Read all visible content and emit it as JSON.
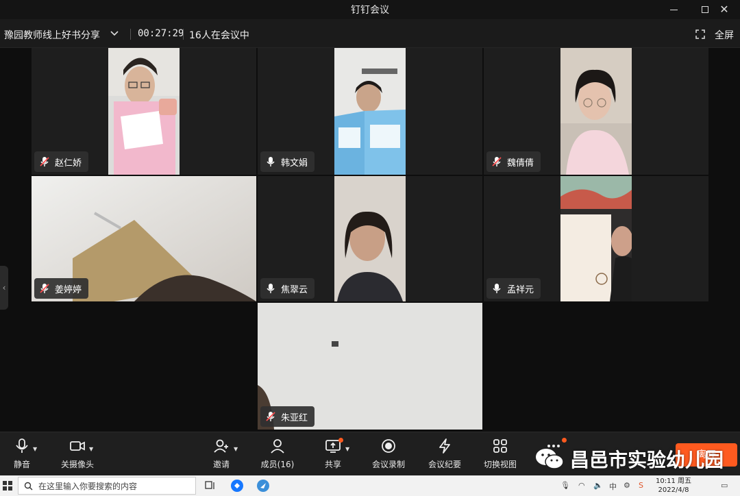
{
  "window": {
    "title": "钉钉会议"
  },
  "meeting": {
    "title": "豫园教师线上好书分享",
    "elapsed": "00:27:29",
    "participants_text": "16人在会议中",
    "fullscreen_label": "全屏"
  },
  "participants": [
    {
      "name": "赵仁娇",
      "mic": "muted"
    },
    {
      "name": "韩文娟",
      "mic": "on"
    },
    {
      "name": "魏倩倩",
      "mic": "muted"
    },
    {
      "name": "姜婷婷",
      "mic": "muted"
    },
    {
      "name": "焦翠云",
      "mic": "on"
    },
    {
      "name": "孟祥元",
      "mic": "on"
    },
    {
      "name": "朱亚红",
      "mic": "muted"
    }
  ],
  "toolbar": {
    "mute_label": "静音",
    "camera_label": "关摄像头",
    "invite_label": "邀请",
    "members_label": "成员(16)",
    "share_label": "共享",
    "record_label": "会议录制",
    "minutes_label": "会议纪要",
    "switch_view_label": "切换视图",
    "leave_label": "离开"
  },
  "watermark": {
    "text": "昌邑市实验幼儿园"
  },
  "taskbar": {
    "search_placeholder": "在这里输入你要搜索的内容",
    "ime_label": "中",
    "time": "10:11 周五",
    "date": "2022/4/8"
  },
  "colors": {
    "accent": "#ff5a1f",
    "toolbar_bg": "#1f1f1f",
    "tile_bg": "#1e1e1e"
  }
}
